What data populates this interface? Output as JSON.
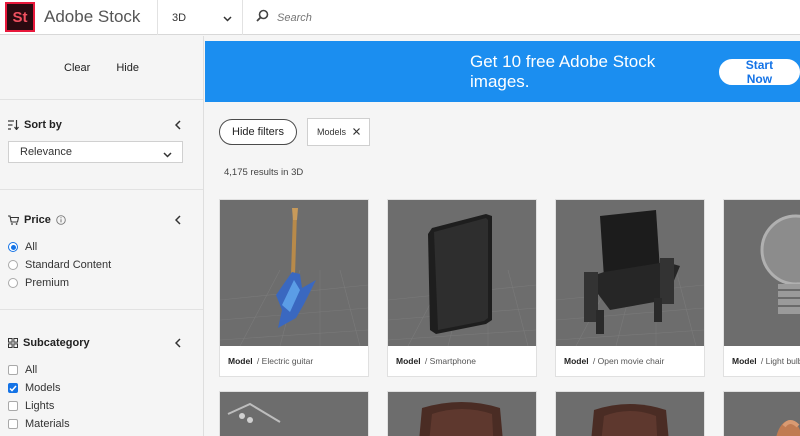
{
  "header": {
    "logo_text": "St",
    "brand": "Adobe Stock",
    "filter_value": "3D",
    "search_placeholder": "Search"
  },
  "sidebar": {
    "clear_label": "Clear",
    "hide_label": "Hide",
    "sort": {
      "title": "Sort by",
      "value": "Relevance"
    },
    "price": {
      "title": "Price",
      "options": [
        {
          "label": "All",
          "selected": true
        },
        {
          "label": "Standard Content",
          "selected": false
        },
        {
          "label": "Premium",
          "selected": false
        }
      ]
    },
    "subcategory": {
      "title": "Subcategory",
      "options": [
        {
          "label": "All",
          "checked": false
        },
        {
          "label": "Models",
          "checked": true
        },
        {
          "label": "Lights",
          "checked": false
        },
        {
          "label": "Materials",
          "checked": false
        }
      ]
    }
  },
  "banner": {
    "text": "Get 10 free Adobe Stock images.",
    "button": "Start Now"
  },
  "toolbar": {
    "hide_filters": "Hide filters",
    "tag": "Models"
  },
  "results": {
    "count_text": "4,175 results in 3D",
    "items": [
      {
        "type": "Model",
        "name": "Electric guitar"
      },
      {
        "type": "Model",
        "name": "Smartphone"
      },
      {
        "type": "Model",
        "name": "Open movie chair"
      },
      {
        "type": "Model",
        "name": "Light bulb"
      }
    ]
  },
  "colors": {
    "accent": "#1473e6",
    "banner": "#1b8ef0",
    "logo_border": "#e8183b",
    "thumb_bg": "#6a6a6a"
  }
}
